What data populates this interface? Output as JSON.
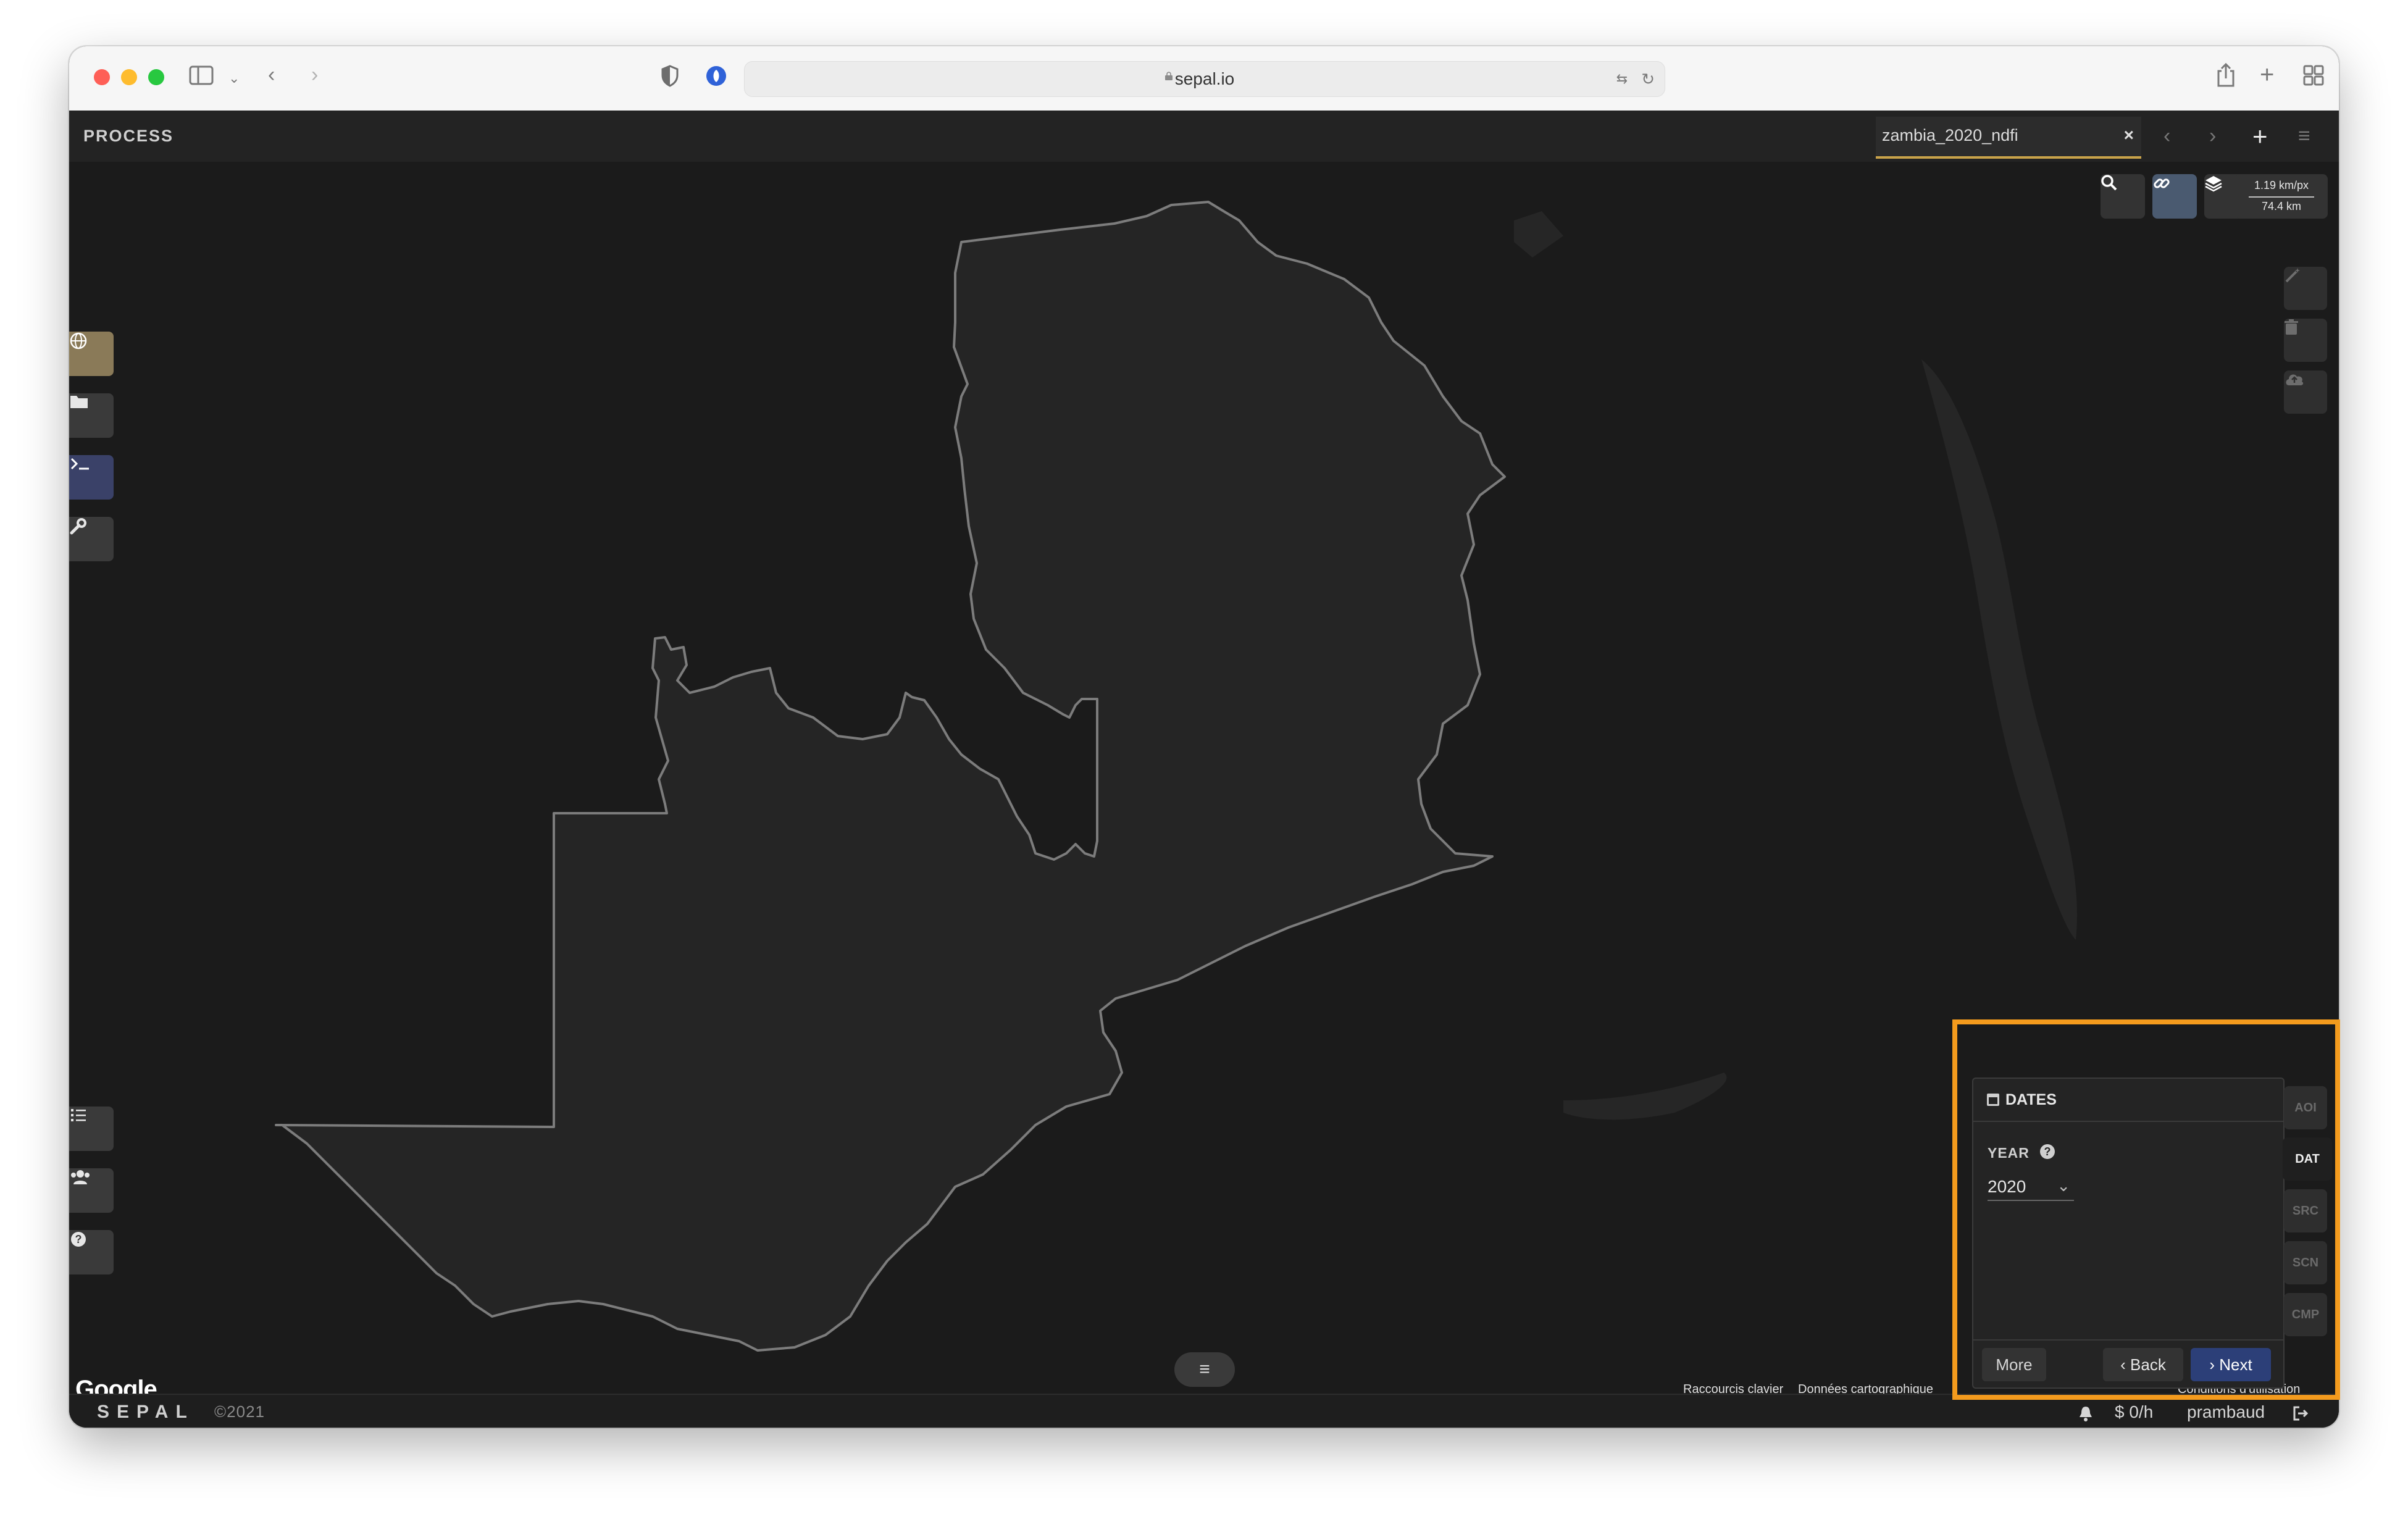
{
  "browser": {
    "url": "sepal.io"
  },
  "app": {
    "section": "PROCESS",
    "recipe_tab": "zambia_2020_ndfi",
    "tab_close": "×"
  },
  "map": {
    "scale_km_per_px": "1.19 km/px",
    "scale_distance": "74.4 km",
    "google_logo": "Google",
    "attribution": {
      "shortcuts": "Raccourcis clavier",
      "map_data": "Données cartographique",
      "terms": "Conditions d'utilisation"
    }
  },
  "panel": {
    "title": "DATES",
    "year_label": "YEAR",
    "year_help": "?",
    "year_value": "2020",
    "buttons": {
      "more": "More",
      "back": "Back",
      "next": "Next"
    },
    "side_tabs": [
      "AOI",
      "DAT",
      "SRC",
      "SCN",
      "CMP"
    ],
    "active_tab": "DAT"
  },
  "footer": {
    "brand": "SEPAL",
    "copyright": "©2021",
    "cost": "$ 0/h",
    "username": "prambaud"
  },
  "colors": {
    "highlight": "#f49b1d",
    "next_button": "#2c3f78",
    "active_tab_underline": "#c9a34a",
    "map_background": "#1b1b1b",
    "country_fill": "#252525"
  },
  "icons": {
    "left_sidebar": [
      "globe-icon",
      "folder-icon",
      "terminal-icon",
      "wrench-icon",
      "tasks-icon",
      "users-icon",
      "help-icon"
    ],
    "map_tools": [
      "search-icon",
      "link-icon",
      "layers-icon"
    ],
    "right_tools": [
      "magic-wand-icon",
      "trash-icon",
      "cloud-upload-icon"
    ]
  }
}
